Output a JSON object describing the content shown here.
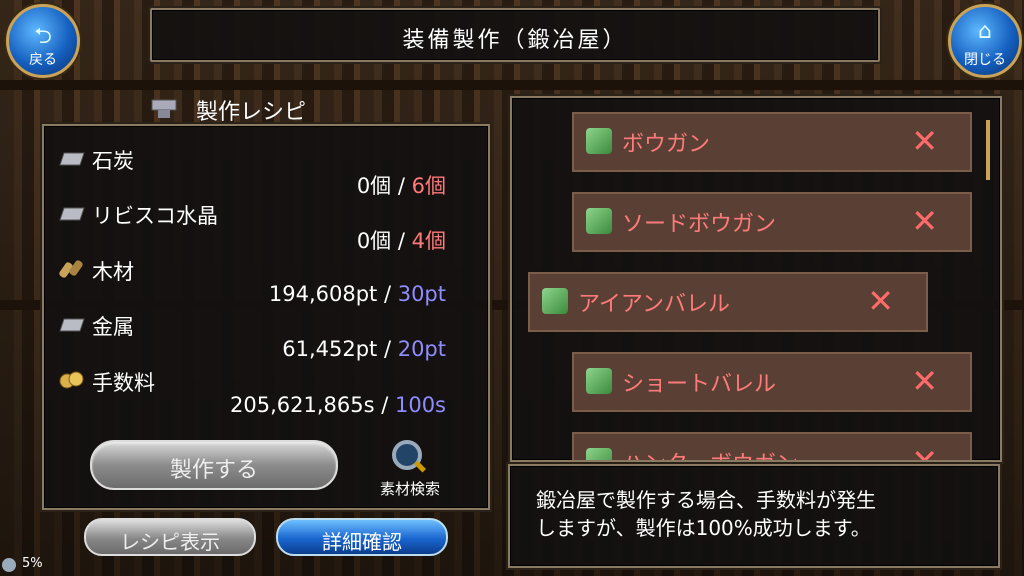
{
  "header": {
    "title": "装備製作（鍛冶屋）"
  },
  "nav": {
    "back_label": "戻る",
    "close_label": "閉じる",
    "back_icon": "back-arrow-icon",
    "close_icon": "home-icon"
  },
  "recipe": {
    "heading": "製作レシピ",
    "materials": [
      {
        "name": "石炭",
        "have": "0個",
        "sep": " / ",
        "need": "6個",
        "need_color": "red",
        "icon": "ingot-icon"
      },
      {
        "name": "リビスコ水晶",
        "have": "0個",
        "sep": " / ",
        "need": "4個",
        "need_color": "red",
        "icon": "ingot-icon"
      },
      {
        "name": "木材",
        "have": "194,608pt",
        "sep": " / ",
        "need": "30pt",
        "need_color": "blue",
        "icon": "wood-icon"
      },
      {
        "name": "金属",
        "have": "61,452pt",
        "sep": " / ",
        "need": "20pt",
        "need_color": "blue",
        "icon": "ingot-icon"
      },
      {
        "name": "手数料",
        "have": "205,621,865s",
        "sep": " / ",
        "need": "100s",
        "need_color": "blue",
        "icon": "coins-icon"
      }
    ],
    "craft_button": "製作する",
    "search_label": "素材検索"
  },
  "bottom_buttons": {
    "recipe_view": "レシピ表示",
    "detail_check": "詳細確認"
  },
  "items": [
    {
      "name": "ボウガン"
    },
    {
      "name": "ソードボウガン"
    },
    {
      "name": "アイアンバレル"
    },
    {
      "name": "ショートバレル"
    },
    {
      "name": "ハンターボウガン"
    }
  ],
  "remove_glyph": "✕",
  "message": {
    "line1": "鍛冶屋で製作する場合、手数料が発生",
    "line2": "しますが、製作は100%成功します。"
  },
  "status": {
    "percent": "5%"
  },
  "colors": {
    "need_red": "#ff7a7a",
    "need_blue": "#8f8cff",
    "accent_blue": "#1a66d0",
    "gold": "#c9a35a"
  }
}
